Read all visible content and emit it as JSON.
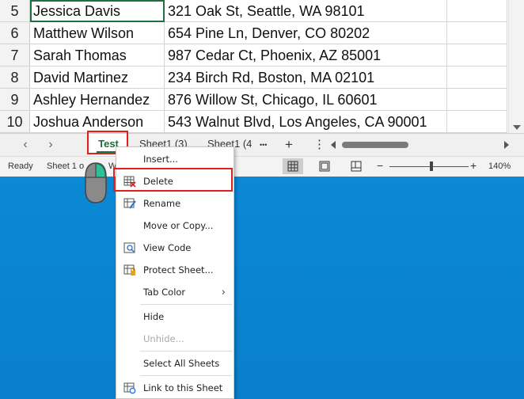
{
  "grid": {
    "rows": [
      {
        "num": "5",
        "name": "Jessica Davis",
        "address": "321 Oak St, Seattle, WA 98101"
      },
      {
        "num": "6",
        "name": "Matthew Wilson",
        "address": "654 Pine Ln, Denver, CO 80202"
      },
      {
        "num": "7",
        "name": "Sarah Thomas",
        "address": "987 Cedar Ct, Phoenix, AZ 85001"
      },
      {
        "num": "8",
        "name": "David Martinez",
        "address": "234 Birch Rd, Boston, MA 02101"
      },
      {
        "num": "9",
        "name": "Ashley Hernandez",
        "address": "876 Willow St, Chicago, IL 60601"
      },
      {
        "num": "10",
        "name": "Joshua Anderson",
        "address": "543 Walnut Blvd, Los Angeles, CA 90001"
      }
    ]
  },
  "tabbar": {
    "prev_glyph": "‹",
    "next_glyph": "›",
    "tabs": [
      "Test",
      "Sheet1 (3)",
      "Sheet1 (4"
    ],
    "more_glyph": "•••",
    "add_glyph": "+",
    "options_glyph": "⋮"
  },
  "status": {
    "ready": "Ready",
    "sheet_info": "Sheet 1 o",
    "sheet_info_tail": "W",
    "zoom_minus": "−",
    "zoom_plus": "+",
    "zoom": "140%"
  },
  "context_menu": {
    "items": [
      {
        "label": "Insert...",
        "icon": "none",
        "disabled": false
      },
      {
        "label": "Delete",
        "icon": "delete-sheet-icon",
        "disabled": false
      },
      {
        "label": "Rename",
        "icon": "rename-sheet-icon",
        "disabled": false
      },
      {
        "label": "Move or Copy...",
        "icon": "none",
        "disabled": false
      },
      {
        "label": "View Code",
        "icon": "view-code-icon",
        "disabled": false
      },
      {
        "label": "Protect Sheet...",
        "icon": "protect-sheet-icon",
        "disabled": false
      },
      {
        "label": "Tab Color",
        "icon": "none",
        "disabled": false,
        "submenu_glyph": "›"
      },
      {
        "label": "Hide",
        "icon": "none",
        "disabled": false
      },
      {
        "label": "Unhide...",
        "icon": "none",
        "disabled": true
      },
      {
        "label": "Select All Sheets",
        "icon": "none",
        "disabled": false
      },
      {
        "label": "Link to this Sheet",
        "icon": "link-sheet-icon",
        "disabled": false
      }
    ]
  },
  "colors": {
    "accent_green": "#1e7145",
    "highlight_red": "#e0201c",
    "desktop_blue": "#0a8bd6"
  }
}
